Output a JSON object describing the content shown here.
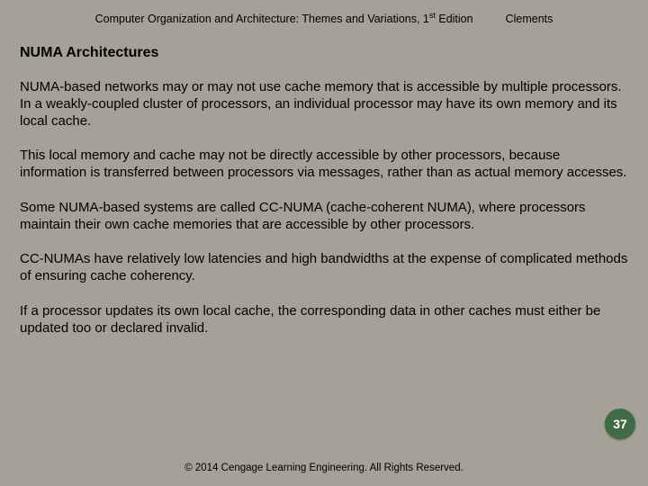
{
  "header": {
    "book_title_prefix": "Computer Organization and Architecture: Themes and Variations, 1",
    "book_title_suffix": " Edition",
    "author": "Clements"
  },
  "section_title": "NUMA Architectures",
  "paragraphs": [
    "NUMA-based networks may or may not use cache memory that is accessible by multiple processors. In a weakly-coupled cluster of processors, an individual processor may have its own memory and its local cache.",
    "This local memory and cache may not be directly accessible by other processors, because information is transferred between processors via messages, rather than as actual memory accesses.",
    "Some NUMA-based systems are called CC-NUMA (cache-coherent NUMA), where processors maintain their own cache memories that are accessible by other processors.",
    "CC-NUMAs have relatively low latencies and high bandwidths at the expense of complicated methods of ensuring cache coherency.",
    "If a processor updates its own local cache, the corresponding data in other caches must either be updated too or declared invalid."
  ],
  "page_number": "37",
  "footer": "© 2014 Cengage Learning Engineering. All Rights Reserved.",
  "sup_text": "st"
}
